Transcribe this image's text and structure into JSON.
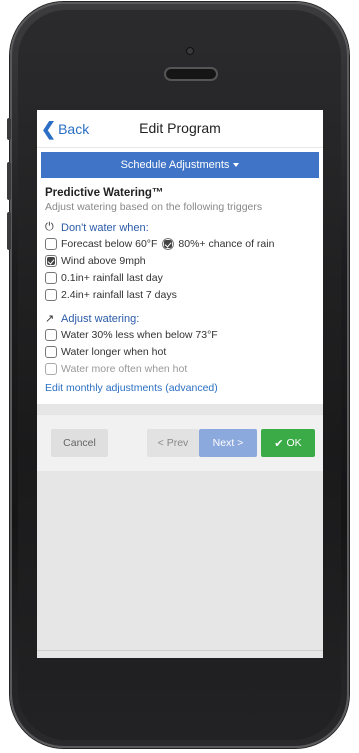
{
  "nav": {
    "back_label": "Back",
    "title": "Edit Program"
  },
  "section": {
    "dropdown_label": "Schedule Adjustments"
  },
  "predictive": {
    "title": "Predictive Watering™",
    "subtitle": "Adjust watering based on the following triggers"
  },
  "dont_water": {
    "heading": "Don't water when:",
    "options": [
      {
        "label": "Forecast below 60°F",
        "checked": false
      },
      {
        "label": "80%+ chance of rain",
        "checked": true
      },
      {
        "label": "Wind above 9mph",
        "checked": true
      },
      {
        "label": "0.1in+ rainfall last day",
        "checked": false
      },
      {
        "label": "2.4in+ rainfall last 7 days",
        "checked": false
      }
    ]
  },
  "adjust": {
    "heading": "Adjust watering:",
    "options": [
      {
        "label": "Water 30% less when below 73°F",
        "checked": false
      },
      {
        "label": "Water longer when hot",
        "checked": false
      },
      {
        "label": "Water more often when hot",
        "checked": false,
        "disabled": true
      }
    ],
    "link": "Edit monthly adjustments (advanced)"
  },
  "footer": {
    "cancel": "Cancel",
    "prev": "< Prev",
    "next": "Next >",
    "ok": "OK"
  },
  "icons": {
    "power": "power-icon",
    "wand": "wand-icon",
    "check": "check-icon",
    "back": "chevron-left-icon"
  },
  "colors": {
    "accent": "#3f74c6",
    "link": "#2b6fc4",
    "ok": "#3aab47",
    "next": "#8ca9dd"
  }
}
